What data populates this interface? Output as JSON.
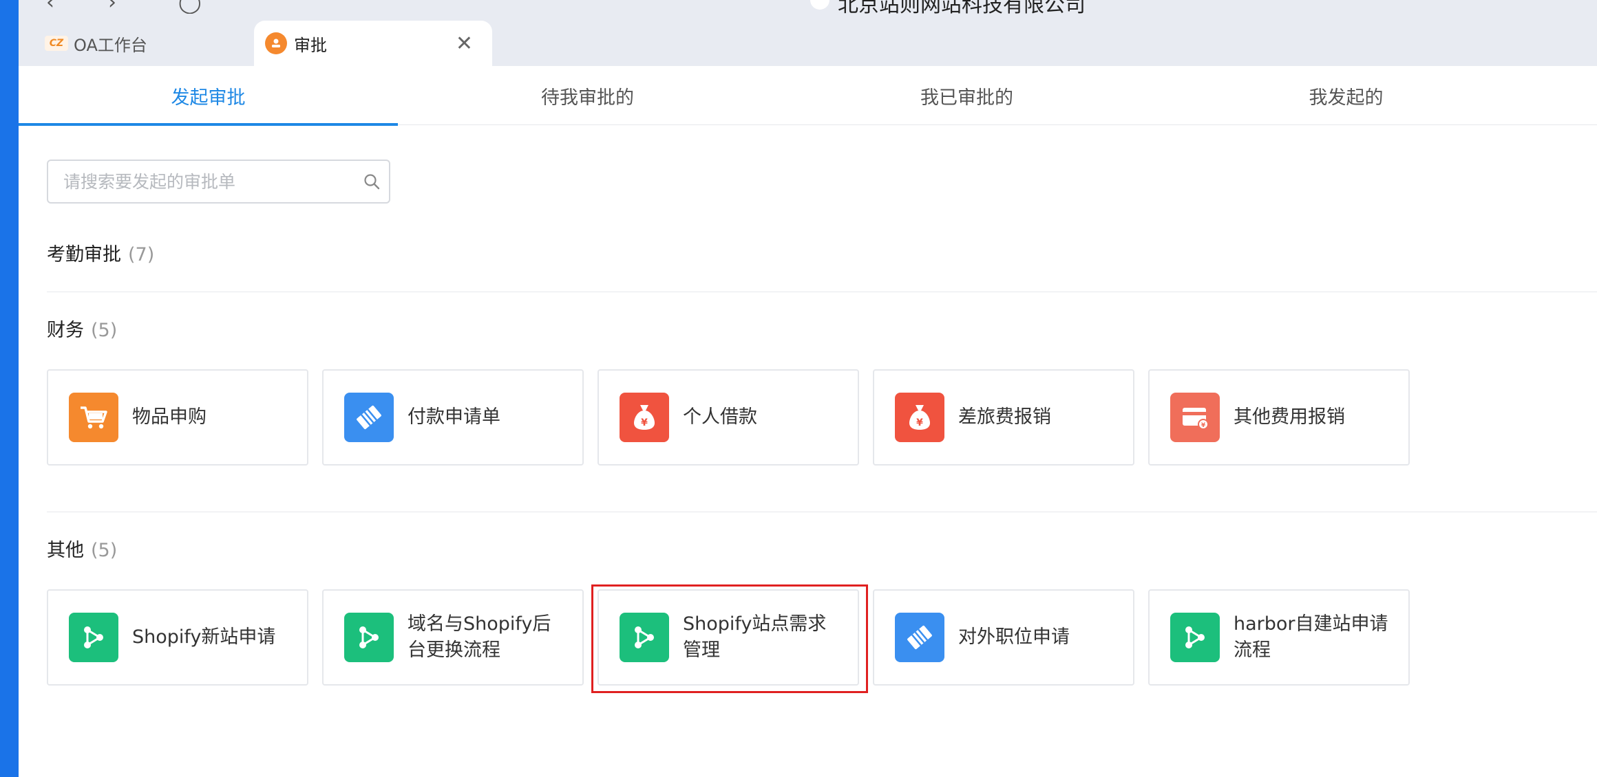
{
  "window": {
    "title": "北京站则网站科技有限公司"
  },
  "tabs": [
    {
      "label": "OA工作台",
      "logo_text": "CZ"
    },
    {
      "label": "审批",
      "close": "✕"
    }
  ],
  "subtabs": [
    {
      "label": "发起审批",
      "active": true
    },
    {
      "label": "待我审批的",
      "active": false
    },
    {
      "label": "我已审批的",
      "active": false
    },
    {
      "label": "我发起的",
      "active": false
    }
  ],
  "search": {
    "placeholder": "请搜索要发起的审批单"
  },
  "sections": {
    "attendance": {
      "title": "考勤审批",
      "count": "(7)"
    },
    "finance": {
      "title": "财务",
      "count": "(5)",
      "items": [
        {
          "label": "物品申购",
          "icon": "cart-icon",
          "color": "#f5892e"
        },
        {
          "label": "付款申请单",
          "icon": "payment-icon",
          "color": "#3a8ff0"
        },
        {
          "label": "个人借款",
          "icon": "money-bag-icon",
          "color": "#f0533f"
        },
        {
          "label": "差旅费报销",
          "icon": "money-bag-icon",
          "color": "#f0533f"
        },
        {
          "label": "其他费用报销",
          "icon": "card-icon",
          "color": "#f06e5a"
        }
      ]
    },
    "other": {
      "title": "其他",
      "count": "(5)",
      "items": [
        {
          "label": "Shopify新站申请",
          "icon": "flow-icon",
          "color": "#1cbf7c"
        },
        {
          "label": "域名与Shopify后台更换流程",
          "icon": "flow-icon",
          "color": "#1cbf7c"
        },
        {
          "label": "Shopify站点需求管理",
          "icon": "flow-icon",
          "color": "#1cbf7c"
        },
        {
          "label": "对外职位申请",
          "icon": "payment-icon",
          "color": "#3a8ff0"
        },
        {
          "label": "harbor自建站申请流程",
          "icon": "flow-icon",
          "color": "#1cbf7c"
        }
      ]
    }
  }
}
